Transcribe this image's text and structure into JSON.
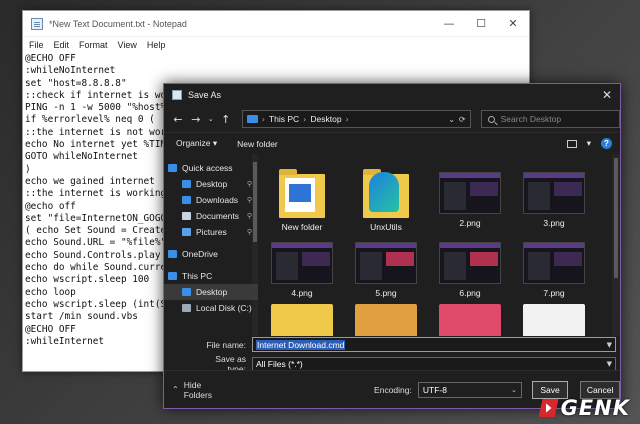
{
  "notepad": {
    "title": "*New Text Document.txt - Notepad",
    "controls": {
      "minimize": "—",
      "maximize": "☐",
      "close": "✕"
    },
    "menu": [
      "File",
      "Edit",
      "Format",
      "View",
      "Help"
    ],
    "lines": [
      "@ECHO OFF",
      ":whileNoInternet",
      "set \"host=8.8.8.8\"",
      "::check if internet is wor",
      "PING -n 1 -w 5000 \"%host%\"",
      "if %errorlevel% neq 0 (",
      "::the internet is not work",
      "echo No internet yet %TIME",
      "GOTO whileNoInternet",
      ")",
      "echo we gained internet",
      "::the internet is working",
      "@echo off",
      "set \"file=InternetON_GOGO",
      "( echo Set Sound = Create",
      "echo Sound.URL = \"%file%\"",
      "echo Sound.Controls.play",
      "echo do while Sound.curren",
      "echo wscript.sleep 100",
      "echo loop",
      "echo wscript.sleep (int(So",
      "start /min sound.vbs",
      "@ECHO OFF",
      ":whileInternet"
    ]
  },
  "dialog": {
    "title": "Save As",
    "close": "✕",
    "nav": {
      "back": "←",
      "forward": "→",
      "recent": "⌄",
      "up": "↑"
    },
    "address": {
      "parts": [
        "This PC",
        "Desktop"
      ],
      "sep": "›",
      "dropdown": "⌄",
      "refresh": "⟳"
    },
    "search_placeholder": "Search Desktop",
    "toolbar": {
      "organize": "Organize ▾",
      "new_folder": "New folder",
      "view": "▾",
      "help": "?"
    },
    "sidebar": [
      {
        "label": "Quick access",
        "color": "#3a8ee6",
        "indent": false,
        "pin": false
      },
      {
        "label": "Desktop",
        "color": "#3a8ee6",
        "indent": true,
        "pin": true
      },
      {
        "label": "Downloads",
        "color": "#3a8ee6",
        "indent": true,
        "pin": true
      },
      {
        "label": "Documents",
        "color": "#c9d4e0",
        "indent": true,
        "pin": true
      },
      {
        "label": "Pictures",
        "color": "#5aa0e6",
        "indent": true,
        "pin": true
      },
      {
        "label": "OneDrive",
        "color": "#3a8ee6",
        "indent": false,
        "pin": false
      },
      {
        "label": "This PC",
        "color": "#3a8ee6",
        "indent": false,
        "pin": false
      },
      {
        "label": "Desktop",
        "color": "#3a8ee6",
        "indent": true,
        "pin": false,
        "selected": true
      },
      {
        "label": "Local Disk (C:)",
        "color": "#9aa8b8",
        "indent": true,
        "pin": false
      }
    ],
    "pin_glyph": "📌",
    "files": [
      {
        "label": "New folder",
        "kind": "folder"
      },
      {
        "label": "UnxUtils",
        "kind": "folder-logo"
      },
      {
        "label": "2.png",
        "kind": "shot"
      },
      {
        "label": "3.png",
        "kind": "shot"
      },
      {
        "label": "4.png",
        "kind": "shot"
      },
      {
        "label": "5.png",
        "kind": "shot-accent"
      },
      {
        "label": "6.png",
        "kind": "shot-accent"
      },
      {
        "label": "7.png",
        "kind": "shot"
      }
    ],
    "file_name_label": "File name:",
    "file_name_value": "Internet Download.cmd",
    "save_as_type_label": "Save as type:",
    "save_as_type_value": "All Files  (*.*)",
    "hide_folders": "Hide Folders",
    "encoding_label": "Encoding:",
    "encoding_value": "UTF-8",
    "save": "Save",
    "cancel": "Cancel"
  },
  "watermark": {
    "text": "GENK"
  }
}
